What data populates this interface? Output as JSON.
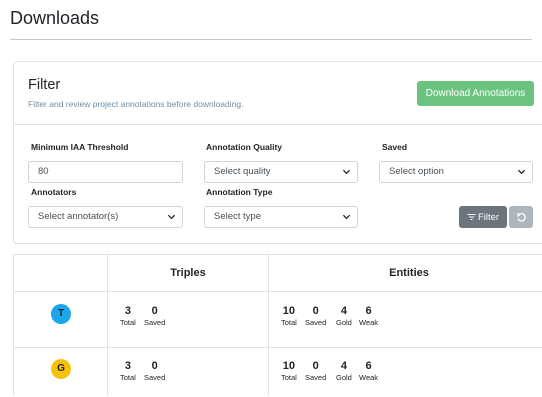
{
  "page": {
    "title": "Downloads"
  },
  "filter": {
    "title": "Filter",
    "subtitle": "Filter and review project annotations before downloading.",
    "download_label": "Download Annotations",
    "fields": {
      "min_iaa": {
        "label": "Minimum IAA Threshold",
        "value": "80"
      },
      "quality": {
        "label": "Annotation Quality",
        "value": "Select quality"
      },
      "saved": {
        "label": "Saved",
        "value": "Select option"
      },
      "annotators": {
        "label": "Annotators",
        "value": "Select annotator(s)"
      },
      "type": {
        "label": "Annotation Type",
        "value": "Select type"
      }
    },
    "filter_label": "Filter"
  },
  "table": {
    "headers": {
      "triples": "Triples",
      "entities": "Entities"
    },
    "rows": [
      {
        "avatar": {
          "letter": "T",
          "color": "#1aa6e8"
        },
        "triples": [
          {
            "num": "3",
            "cap": "Total"
          },
          {
            "num": "0",
            "cap": "Saved"
          }
        ],
        "entities": [
          {
            "num": "10",
            "cap": "Total"
          },
          {
            "num": "0",
            "cap": "Saved"
          },
          {
            "num": "4",
            "cap": "Gold"
          },
          {
            "num": "6",
            "cap": "Weak"
          }
        ]
      },
      {
        "avatar": {
          "letter": "G",
          "color": "#f5c20b"
        },
        "triples": [
          {
            "num": "3",
            "cap": "Total"
          },
          {
            "num": "0",
            "cap": "Saved"
          }
        ],
        "entities": [
          {
            "num": "10",
            "cap": "Total"
          },
          {
            "num": "0",
            "cap": "Saved"
          },
          {
            "num": "4",
            "cap": "Gold"
          },
          {
            "num": "6",
            "cap": "Weak"
          }
        ]
      }
    ]
  },
  "colors": {
    "accent_success": "#6cc27f",
    "secondary": "#6c757d",
    "border": "#dee2e6"
  },
  "icons": {
    "filter": "filter-lines-icon",
    "reset": "undo-icon",
    "dropdown": "chevron-down-icon"
  }
}
